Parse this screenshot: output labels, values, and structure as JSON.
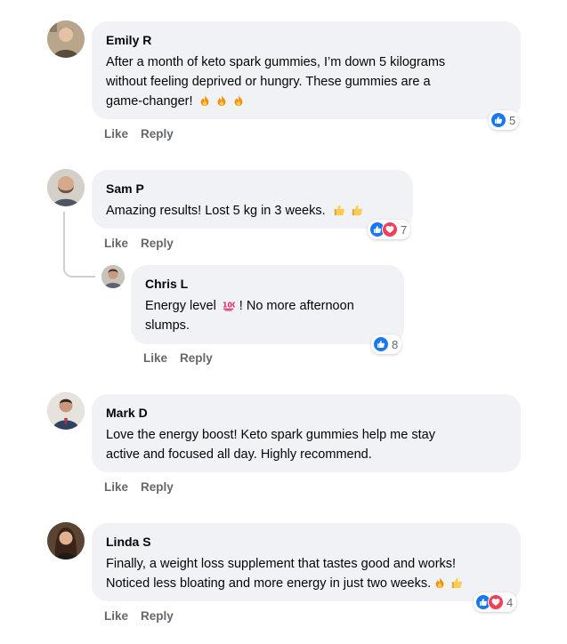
{
  "comments": [
    {
      "name": "Emily R",
      "lines": [
        "After a month of keto spark gummies, I’m down 5 kilograms",
        "without feeling deprived or hungry. These gummies are a",
        "game-changer!"
      ],
      "reaction_count": "5",
      "emoji": [
        "fire",
        "fire",
        "fire"
      ]
    },
    {
      "name": "Sam P",
      "lines": [
        "Amazing results! Lost 5 kg in 3 weeks."
      ],
      "reaction_count": "7",
      "emoji": [
        "thumbs-up",
        "thumbs-up"
      ]
    },
    {
      "name": "Chris L",
      "line1_a": "Energy level",
      "line1_b": "! No more afternoon",
      "line2": "slumps.",
      "reaction_count": "8",
      "emoji": [
        "hundred-points"
      ]
    },
    {
      "name": "Mark D",
      "lines": [
        "Love the energy boost! Keto spark gummies help me stay",
        "active and focused all day. Highly recommend."
      ],
      "emoji": []
    },
    {
      "name": "Linda S",
      "lines": [
        "Finally, a weight loss supplement that tastes good and works!",
        "Noticed less bloating and more energy in just two weeks."
      ],
      "reaction_count": "4",
      "emoji": [
        "fire",
        "thumbs-up"
      ]
    }
  ],
  "actions": {
    "like": "Like",
    "reply": "Reply"
  },
  "colors": {
    "bubble": "#f0f2f5",
    "like_blue": "#1877f2",
    "love_red": "#f33e58",
    "meta_gray": "#65676b"
  }
}
